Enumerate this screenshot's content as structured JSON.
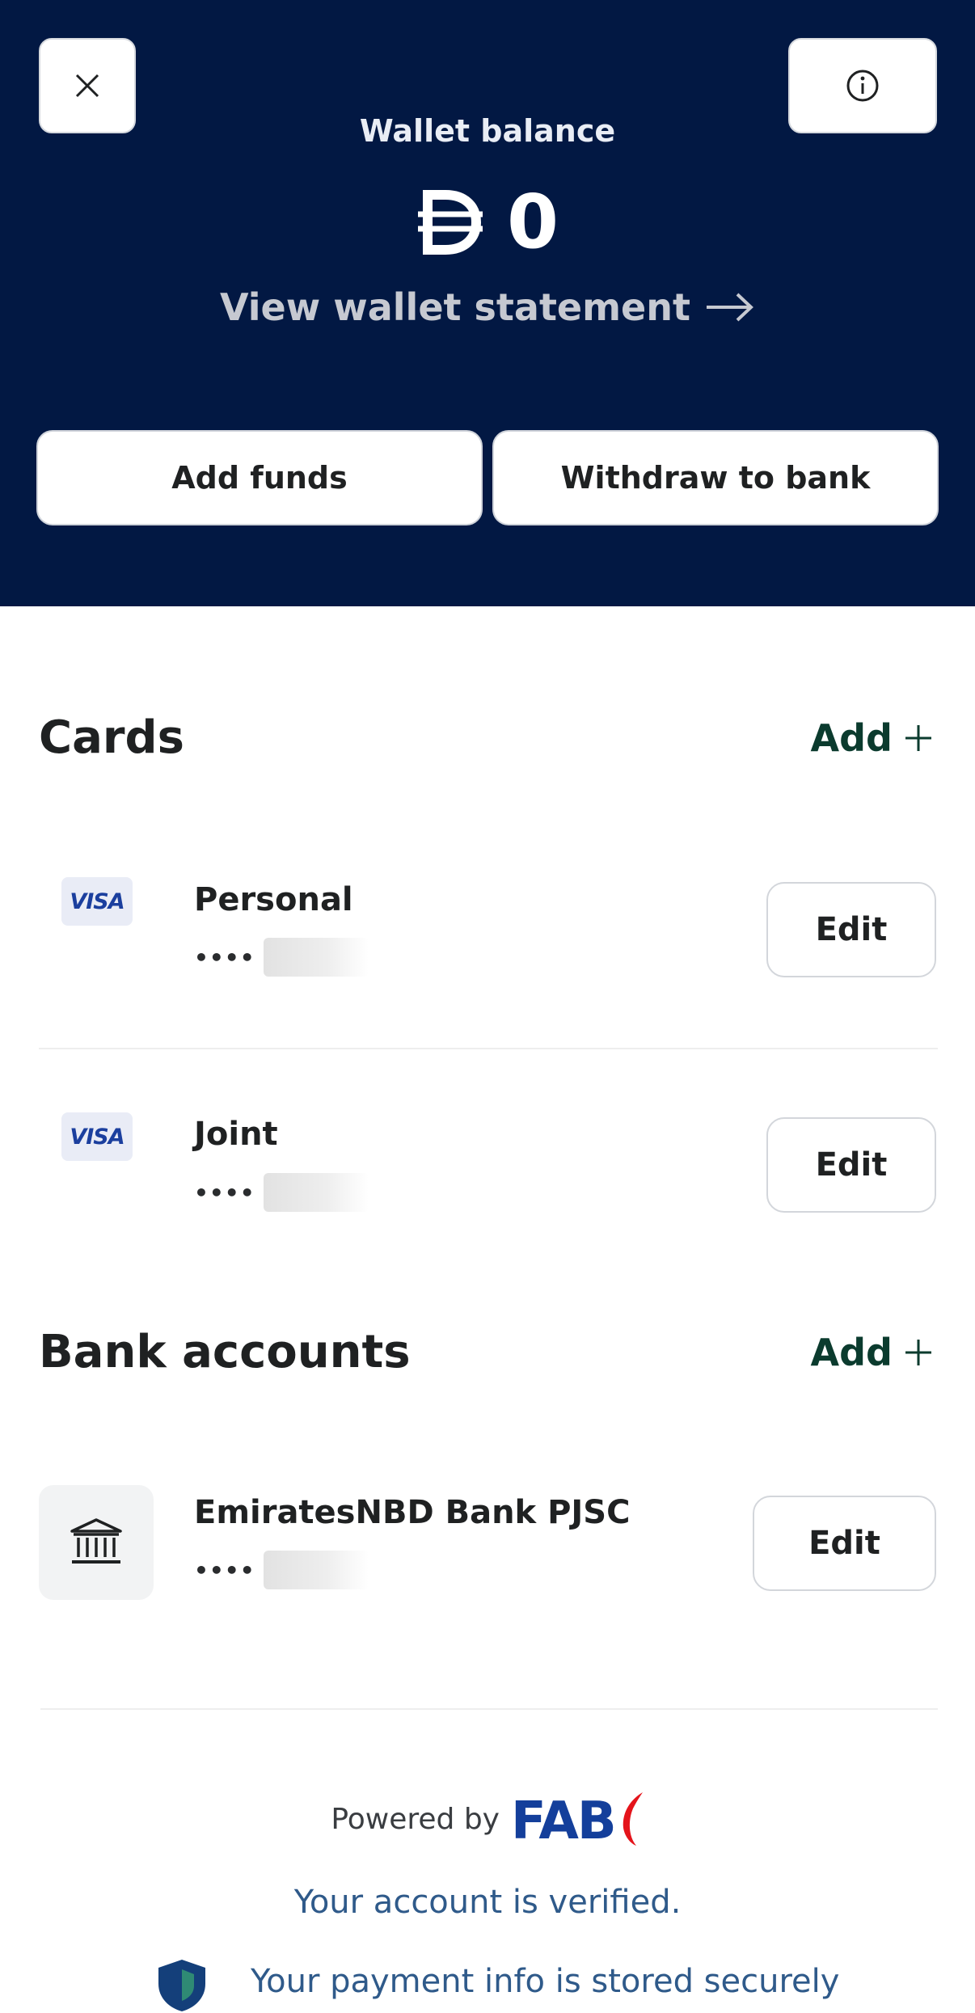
{
  "header": {
    "close_icon": "close-icon",
    "info_icon": "info-icon",
    "wallet_label": "Wallet balance",
    "currency_icon": "dirham-icon",
    "balance": "0",
    "statement_link": "View wallet statement",
    "add_funds": "Add funds",
    "withdraw": "Withdraw to bank",
    "background_color": "#021843"
  },
  "cards": {
    "title": "Cards",
    "add_label": "Add",
    "items": [
      {
        "brand": "VISA",
        "name": "Personal",
        "mask": "••••",
        "edit": "Edit"
      },
      {
        "brand": "VISA",
        "name": "Joint",
        "mask": "••••",
        "edit": "Edit"
      }
    ]
  },
  "bank_accounts": {
    "title": "Bank accounts",
    "add_label": "Add",
    "items": [
      {
        "icon": "bank-icon",
        "name": "EmiratesNBD Bank PJSC",
        "mask": "••••",
        "edit": "Edit"
      }
    ]
  },
  "footer": {
    "powered_by": "Powered by",
    "logo_text": "FAB",
    "verified": "Your account is verified.",
    "secure_text": "Your payment info is stored securely"
  },
  "accent_color": "#0b3b2e"
}
